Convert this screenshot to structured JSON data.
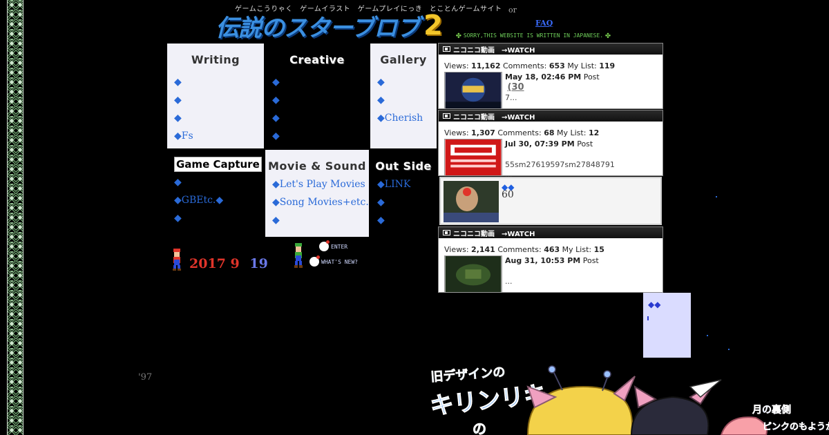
{
  "header": {
    "tagline": "ゲームこうりゃく　ゲームイラスト　ゲームプレイにっき　とことんゲームサイト",
    "logo_text": "伝説のスターブロブ",
    "logo_number": "2",
    "notice": "SORRY,THIS WEBSITE IS WRITTEN IN JAPANESE.",
    "or_text": "or",
    "faq_label": "FAQ"
  },
  "menu": {
    "writing": {
      "title": "Writing",
      "items": [
        "◆",
        "◆",
        "◆",
        "◆Fs"
      ]
    },
    "creative": {
      "title": "Creative",
      "items": [
        "◆",
        "◆",
        "◆",
        "◆"
      ]
    },
    "gallery": {
      "title": "Gallery",
      "items": [
        "◆",
        "◆",
        "◆Cherish"
      ]
    },
    "game_capture": {
      "title": "Game Capture",
      "items": [
        "◆",
        "◆GBEtc.◆",
        "◆"
      ]
    },
    "movie_sound": {
      "title": "Movie & Sound",
      "items": [
        "◆Let's Play Movies",
        "◆Song Movies+etc.",
        "◆"
      ]
    },
    "out_side": {
      "title": "Out Side",
      "items": [
        "◆LINK",
        "◆",
        "◆"
      ]
    }
  },
  "date": {
    "year": "2017",
    "month": "9",
    "day": "19"
  },
  "links": {
    "enter": "ENTER",
    "whats_new": "WHAT'S NEW?"
  },
  "videos": [
    {
      "header": "ニコニコ動画　→WATCH",
      "views_label": "Views:",
      "views": "11,162",
      "comments_label": "Comments:",
      "comments": "653",
      "mylist_label": "My List:",
      "mylist": "119",
      "date": "May 18, 02:46 PM",
      "post_label": "Post",
      "title": "(30",
      "desc": "7..."
    },
    {
      "header": "ニコニコ動画　→WATCH",
      "views_label": "Views:",
      "views": "1,307",
      "comments_label": "Comments:",
      "comments": "68",
      "mylist_label": "My List:",
      "mylist": "12",
      "date": "Jul 30, 07:39 PM",
      "post_label": "Post",
      "title": "",
      "desc": "55sm27619597sm27848791\n..."
    },
    {
      "header": "ニコニコ動画　→WATCH",
      "views_label": "Views:",
      "views": "2,141",
      "comments_label": "Comments:",
      "comments": "463",
      "mylist_label": "My List:",
      "mylist": "15",
      "date": "Aug 31, 10:53 PM",
      "post_label": "Post",
      "title": "",
      "desc": "..."
    }
  ],
  "card3": {
    "title": "◆◆",
    "count": "60"
  },
  "side_box": {
    "title": "◆◆"
  },
  "since": "'97",
  "banner": {
    "line1": "旧デザインの",
    "line2": "キリンリキ",
    "line3": "の",
    "aside1": "月の裏側",
    "aside2": "ピンクのもようか"
  },
  "colors": {
    "accent_blue": "#2a6ad8",
    "date_red": "#e0342a",
    "date_blue": "#6a78e8",
    "panel_light": "#f1f1f8"
  }
}
